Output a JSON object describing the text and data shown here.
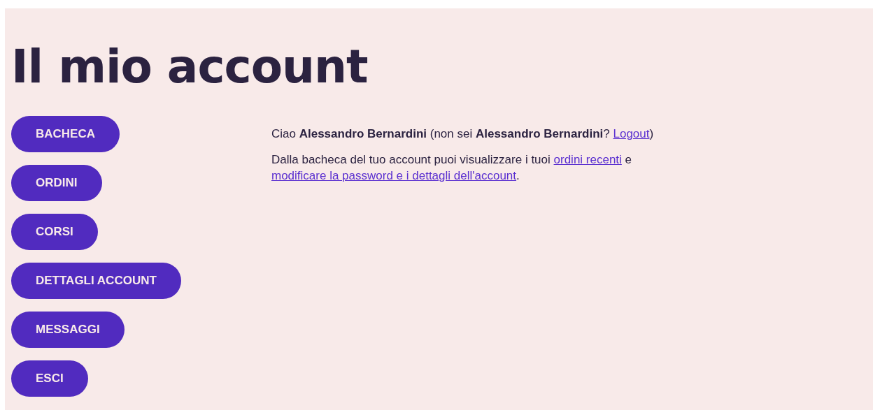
{
  "title": "Il mio account",
  "nav": [
    {
      "label": "BACHECA"
    },
    {
      "label": "ORDINI"
    },
    {
      "label": "CORSI"
    },
    {
      "label": "DETTAGLI ACCOUNT"
    },
    {
      "label": "MESSAGGI"
    },
    {
      "label": "ESCI"
    }
  ],
  "paragraphs": [
    [
      {
        "kind": "text",
        "text": "Ciao **Alessandro Bernardini** (non sei **Alessandro Bernardini**? "
      },
      {
        "kind": "link",
        "text": "Logout"
      },
      {
        "kind": "text",
        "text": ")"
      }
    ],
    [
      {
        "kind": "text",
        "text": "Dalla bacheca del tuo account puoi visualizzare i tuoi "
      },
      {
        "kind": "link",
        "text": "ordini recenti"
      },
      {
        "kind": "text",
        "text": " e "
      },
      {
        "kind": "link",
        "text": "modificare la password e i dettagli dell'account"
      },
      {
        "kind": "text",
        "text": "."
      }
    ]
  ]
}
